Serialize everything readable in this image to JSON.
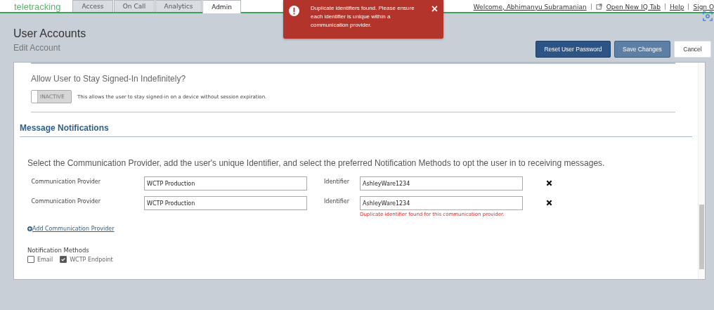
{
  "header": {
    "logo": "teletracking",
    "tabs": [
      {
        "label": "Access",
        "selected": false
      },
      {
        "label": "On Call",
        "selected": false
      },
      {
        "label": "Analytics",
        "selected": false
      },
      {
        "label": "Admin",
        "selected": true
      }
    ],
    "links": [
      "Welcome, Abhimanyu Subramanian",
      "Open New IQ Tab",
      "Help",
      "Sign O"
    ]
  },
  "toast": {
    "message": "Duplicate identifiers found. Please ensure each identifier is unique within a communication provider.",
    "close": "×"
  },
  "page": {
    "title": "User Accounts",
    "subtitle": "Edit Account",
    "buttons": [
      {
        "label": "Reset User Password",
        "kind": "primary"
      },
      {
        "label": "Save Changes",
        "kind": "secondary"
      },
      {
        "label": "Cancel",
        "kind": "plain"
      }
    ]
  },
  "stay_signed_in": {
    "question": "Allow User to Stay Signed-In Indefinitely?",
    "toggle": {
      "label": "INACTIVE",
      "on": false
    },
    "description": "This allows the user to stay signed-in on a device without session expiration."
  },
  "message_notifications": {
    "heading": "Message Notifications",
    "instructions": "Select the Communication Provider, add the user's unique Identifier, and select the preferred Notification Methods to opt the user in to receiving messages.",
    "providers": [
      {
        "provider_label": "Communication Provider",
        "provider": "WCTP Production",
        "identifier_label": "Identifier",
        "identifier": "AshleyWare1234"
      },
      {
        "provider_label": "Communication Provider",
        "provider": "WCTP Production",
        "identifier_label": "Identifier",
        "identifier": "AshleyWare1234",
        "error": "Duplicate identifier found for this communication provider."
      }
    ],
    "add_link": "Add Communication Provider",
    "methods_label": "Notification Methods",
    "methods": [
      {
        "label": "Email",
        "checked": false
      },
      {
        "label": "WCTP Endpoint",
        "checked": true
      }
    ]
  }
}
